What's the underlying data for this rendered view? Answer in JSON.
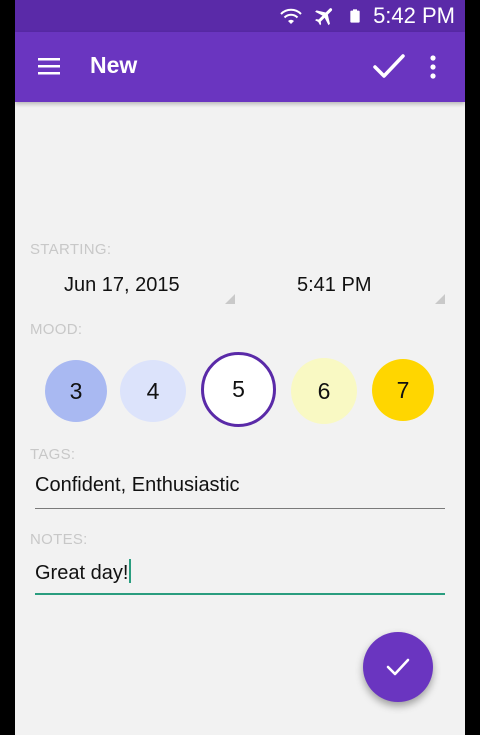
{
  "status_bar": {
    "time": "5:42 PM",
    "icons": [
      "wifi-icon",
      "airplane-mode-icon",
      "battery-icon"
    ]
  },
  "app_bar": {
    "title": "New",
    "actions": [
      "check-icon",
      "more-vert-icon"
    ]
  },
  "starting": {
    "label": "STARTING:",
    "date": "Jun 17, 2015",
    "time": "5:41 PM"
  },
  "mood": {
    "label": "MOOD:",
    "options": [
      {
        "value": "3",
        "color": "#a9b9f2",
        "selected": false
      },
      {
        "value": "4",
        "color": "#dce3fb",
        "selected": false
      },
      {
        "value": "5",
        "color": "#ffffff",
        "selected": true
      },
      {
        "value": "6",
        "color": "#f9f9c3",
        "selected": false
      },
      {
        "value": "7",
        "color": "#ffd600",
        "selected": false
      }
    ]
  },
  "tags": {
    "label": "TAGS:",
    "value": "Confident, Enthusiastic"
  },
  "notes": {
    "label": "NOTES:",
    "value": "Great day!"
  },
  "colors": {
    "primary": "#6a35c0",
    "primary_dark": "#5a2aa8",
    "accent": "#2a9d7f",
    "background": "#f2f2f2",
    "label": "#c8c8c8"
  }
}
